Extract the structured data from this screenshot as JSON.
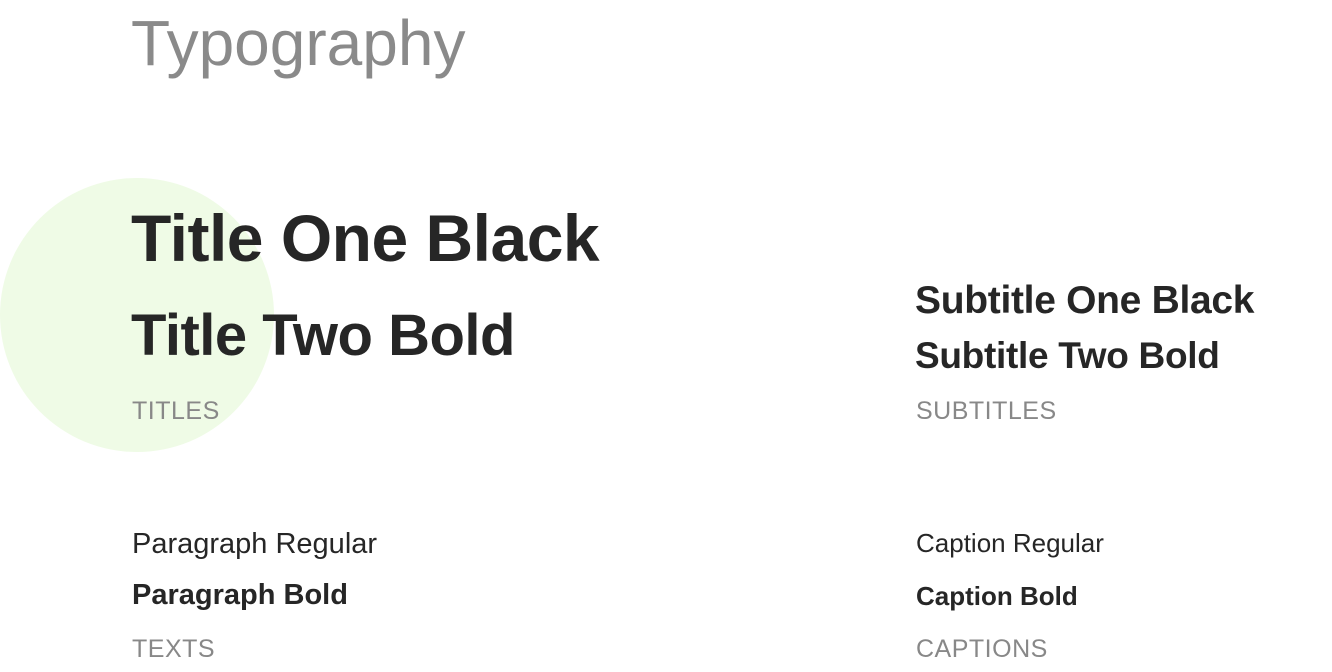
{
  "page": {
    "title": "Typography"
  },
  "colors": {
    "accent_circle": "#effbe6",
    "text_primary": "#262626",
    "text_muted": "#888888"
  },
  "titles": {
    "one": "Title One Black",
    "two": "Title Two Bold",
    "label": "TITLES"
  },
  "subtitles": {
    "one": "Subtitle One Black",
    "two": "Subtitle Two Bold",
    "label": "SUBTITLES"
  },
  "texts": {
    "regular": "Paragraph Regular",
    "bold": "Paragraph Bold",
    "label": "TEXTS"
  },
  "captions": {
    "regular": "Caption Regular",
    "bold": "Caption Bold",
    "label": "CAPTIONS"
  }
}
